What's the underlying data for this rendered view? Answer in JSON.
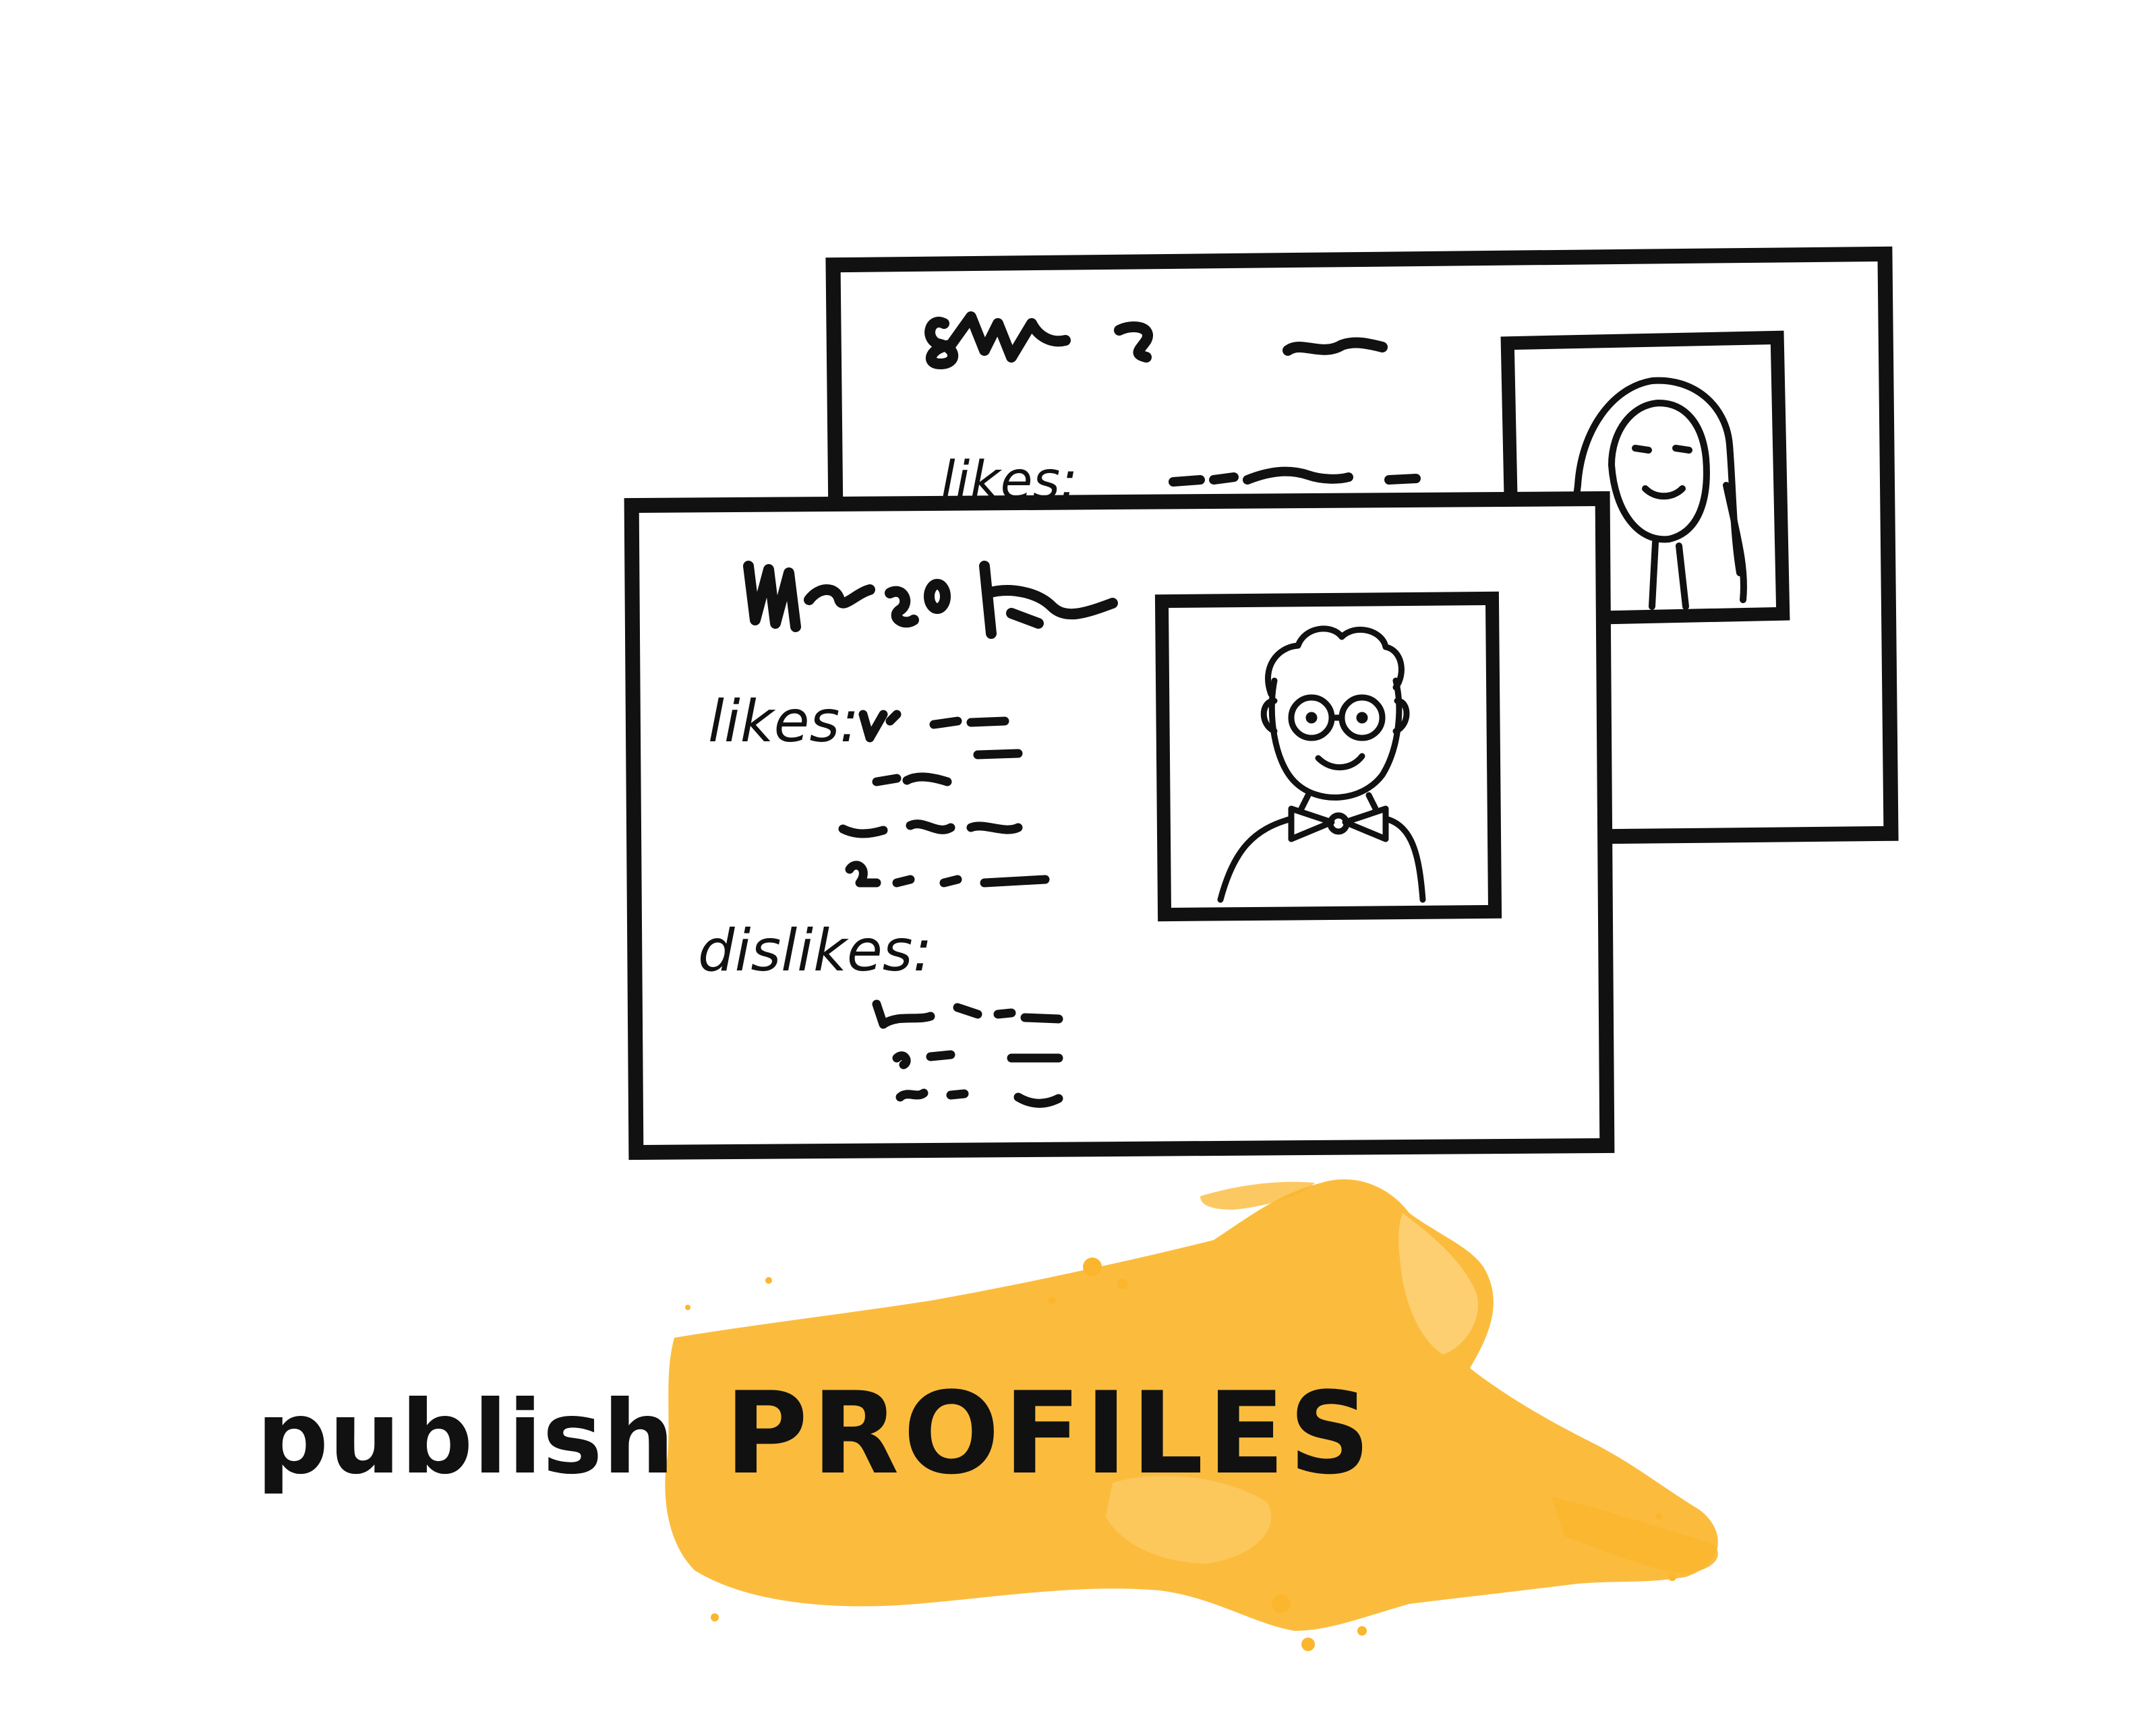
{
  "caption": {
    "verb": "publish",
    "noun": "PROFILES"
  },
  "front_card": {
    "likes_label": "likes:",
    "dislikes_label": "dislikes:"
  },
  "back_card": {
    "likes_label": "likes:"
  },
  "colors": {
    "ink": "#111111",
    "splash": "#FBB62E",
    "splash_light": "#FDD27A",
    "background": "#FFFFFF"
  }
}
